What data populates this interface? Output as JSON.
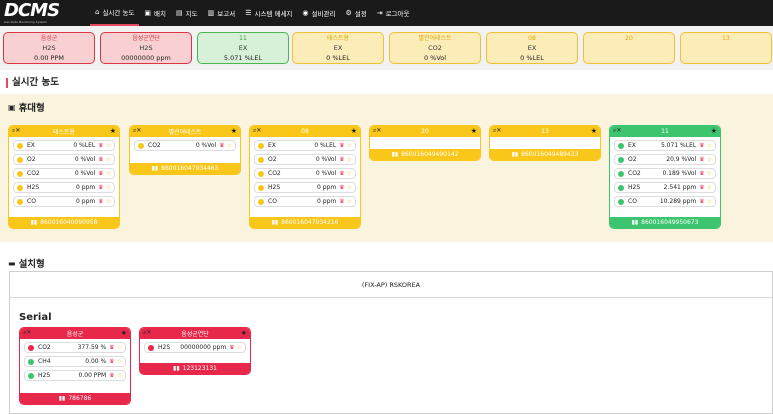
{
  "brand": {
    "logo": "DCMS",
    "tagline": "Gas Data Monitoring System"
  },
  "nav": [
    {
      "icon": "home-icon",
      "glyph": "⌂",
      "label": "실시간 농도",
      "active": true
    },
    {
      "icon": "layout-icon",
      "glyph": "▣",
      "label": "배치"
    },
    {
      "icon": "map-icon",
      "glyph": "▤",
      "label": "지도"
    },
    {
      "icon": "report-icon",
      "glyph": "▥",
      "label": "보고서"
    },
    {
      "icon": "message-icon",
      "glyph": "☰",
      "label": "시스템 메세지"
    },
    {
      "icon": "device-icon",
      "glyph": "◉",
      "label": "설비관리"
    },
    {
      "icon": "gear-icon",
      "glyph": "⚙",
      "label": "설정"
    },
    {
      "icon": "logout-icon",
      "glyph": "⇥",
      "label": "로그아웃"
    }
  ],
  "status": [
    {
      "name": "음성군",
      "gas": "H2S",
      "value": "0.00 PPM",
      "color": "red"
    },
    {
      "name": "음성군연단",
      "gas": "H2S",
      "value": "00000000 ppm",
      "color": "red"
    },
    {
      "name": "11",
      "gas": "EX",
      "value": "5.071 %LEL",
      "color": "green"
    },
    {
      "name": "테스트용",
      "gas": "EX",
      "value": "0 %LEL",
      "color": "yellow"
    },
    {
      "name": "별관어테스트",
      "gas": "CO2",
      "value": "0 %Vol",
      "color": "yellow"
    },
    {
      "name": "08",
      "gas": "EX",
      "value": "0 %LEL",
      "color": "yellow"
    },
    {
      "name": "20",
      "gas": "",
      "value": "",
      "color": "yellow"
    },
    {
      "name": "13",
      "gas": "",
      "value": "",
      "color": "yellow"
    }
  ],
  "section_title": "실시간 농도",
  "portable": {
    "title": "휴대형",
    "cards": [
      {
        "name": "테스트용",
        "color": "yellow",
        "id": "860016040090958",
        "rows": [
          {
            "gas": "EX",
            "value": "0 %LEL",
            "dot": "y"
          },
          {
            "gas": "O2",
            "value": "0 %Vol",
            "dot": "y"
          },
          {
            "gas": "CO2",
            "value": "0 %Vol",
            "dot": "y"
          },
          {
            "gas": "H2S",
            "value": "0 ppm",
            "dot": "y"
          },
          {
            "gas": "CO",
            "value": "0 ppm",
            "dot": "y"
          }
        ]
      },
      {
        "name": "별관어테스트",
        "color": "yellow",
        "id": "860016047934463",
        "rows": [
          {
            "gas": "CO2",
            "value": "0 %Vol",
            "dot": "y"
          }
        ]
      },
      {
        "name": "08",
        "color": "yellow",
        "id": "860016047934216",
        "rows": [
          {
            "gas": "EX",
            "value": "0 %LEL",
            "dot": "y"
          },
          {
            "gas": "O2",
            "value": "0 %Vol",
            "dot": "y"
          },
          {
            "gas": "CO2",
            "value": "0 %Vol",
            "dot": "y"
          },
          {
            "gas": "H2S",
            "value": "0 ppm",
            "dot": "y"
          },
          {
            "gas": "CO",
            "value": "0 ppm",
            "dot": "y"
          }
        ]
      },
      {
        "name": "20",
        "color": "yellow",
        "id": "860016049490142",
        "rows": []
      },
      {
        "name": "13",
        "color": "yellow",
        "id": "860016049489433",
        "rows": []
      },
      {
        "name": "11",
        "color": "green",
        "id": "860016049950673",
        "rows": [
          {
            "gas": "EX",
            "value": "5.071 %LEL",
            "dot": "g"
          },
          {
            "gas": "O2",
            "value": "20.9 %Vol",
            "dot": "g"
          },
          {
            "gas": "CO2",
            "value": "0.189 %Vol",
            "dot": "g"
          },
          {
            "gas": "H2S",
            "value": "2.541 ppm",
            "dot": "g"
          },
          {
            "gas": "CO",
            "value": "10.289 ppm",
            "dot": "g"
          }
        ]
      }
    ]
  },
  "installed": {
    "title": "설치형",
    "frame_title": "(FIX-AP) RSKOREA",
    "group": "Serial",
    "cards": [
      {
        "name": "음성군",
        "color": "red",
        "id": "786786",
        "rows": [
          {
            "gas": "CO2",
            "value": "377.59 %",
            "dot": "r"
          },
          {
            "gas": "CH4",
            "value": "0.00 %",
            "dot": "g"
          },
          {
            "gas": "H2S",
            "value": "0.00 PPM",
            "dot": "g"
          }
        ]
      },
      {
        "name": "음성군연단",
        "color": "red",
        "id": "123123131",
        "rows": [
          {
            "gas": "H2S",
            "value": "00000000 ppm",
            "dot": "r"
          }
        ]
      }
    ]
  }
}
